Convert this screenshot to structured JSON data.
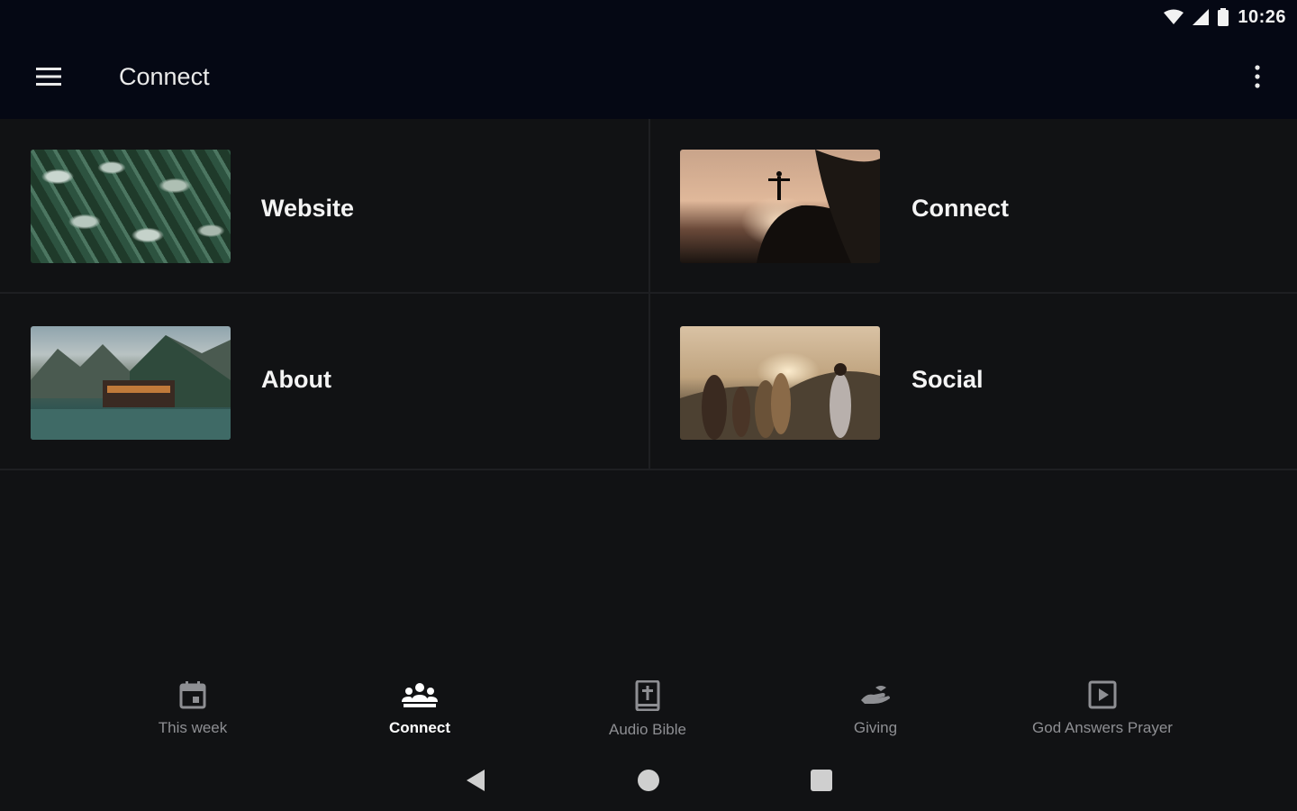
{
  "status_bar": {
    "time": "10:26",
    "icons": [
      "wifi-icon",
      "cellular-signal-icon",
      "battery-icon"
    ]
  },
  "app_bar": {
    "title": "Connect",
    "menu_icon": "hamburger-menu-icon",
    "overflow_icon": "more-vertical-icon"
  },
  "tiles": [
    {
      "label": "Website",
      "image": "leaves-thumbnail"
    },
    {
      "label": "Connect",
      "image": "sunset-silhouette-thumbnail"
    },
    {
      "label": "About",
      "image": "mountain-lake-thumbnail"
    },
    {
      "label": "Social",
      "image": "group-sunset-thumbnail"
    }
  ],
  "bottom_nav": {
    "items": [
      {
        "label": "This week",
        "icon": "calendar-icon",
        "active": false
      },
      {
        "label": "Connect",
        "icon": "group-icon",
        "active": true
      },
      {
        "label": "Audio Bible",
        "icon": "bible-icon",
        "active": false
      },
      {
        "label": "Giving",
        "icon": "giving-hand-icon",
        "active": false
      },
      {
        "label": "God Answers Prayer",
        "icon": "play-box-icon",
        "active": false
      }
    ]
  },
  "system_nav": {
    "icons": [
      "back-icon",
      "home-icon",
      "recents-icon"
    ]
  },
  "colors": {
    "bar_background": "#050814",
    "page_background": "#111214",
    "divider": "#1e1f22",
    "inactive_nav": "#8e8f93",
    "active_nav": "#ffffff"
  }
}
